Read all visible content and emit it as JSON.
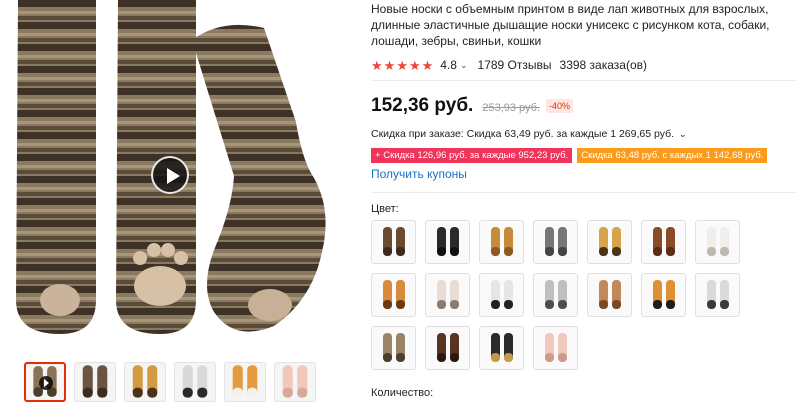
{
  "product": {
    "title": "Новые носки с объемным принтом в виде лап животных для взрослых, длинные эластичные дышащие носки унисекс с рисунком кота, собаки, лошади, зебры, свиньи, кошки",
    "rating": "4.8",
    "reviews": "1789 Отзывы",
    "orders": "3398 заказа(ов)",
    "star_count": 5
  },
  "price": {
    "current": "152,36 руб.",
    "original": "253,93 руб.",
    "discount": "-40%"
  },
  "promos": {
    "order_discount": "Скидка при заказе: Скидка 63,49 руб. за каждые 1 269,65 руб.",
    "coupon_red": "Скидка 126,96 руб. за каждые 952,23 руб.",
    "coupon_orange": "Скидка 63,48 руб. с каждых 1 142,68 руб.",
    "get_coupons": "Получить купоны"
  },
  "options": {
    "color_label": "Цвет:",
    "quantity_label": "Количество:",
    "swatches": [
      {
        "name": "brown-stripe",
        "colors": [
          "#6b4a32",
          "#3d2a1e"
        ]
      },
      {
        "name": "black",
        "colors": [
          "#2a2a2a",
          "#111111"
        ]
      },
      {
        "name": "golden",
        "colors": [
          "#c68a3a",
          "#8a5a22"
        ]
      },
      {
        "name": "grey",
        "colors": [
          "#777777",
          "#444444"
        ]
      },
      {
        "name": "leopard",
        "colors": [
          "#d8a34a",
          "#4a3418"
        ]
      },
      {
        "name": "chestnut",
        "colors": [
          "#8a4b28",
          "#5a2e16"
        ]
      },
      {
        "name": "white",
        "colors": [
          "#f0eeea",
          "#bdb8b0"
        ]
      },
      {
        "name": "tiger-orange",
        "colors": [
          "#d98a3c",
          "#6a3a14"
        ]
      },
      {
        "name": "pink-white",
        "colors": [
          "#e8dcd6",
          "#8a7b72"
        ]
      },
      {
        "name": "zebra",
        "colors": [
          "#e6e6e6",
          "#222222"
        ]
      },
      {
        "name": "snow-leopard",
        "colors": [
          "#bfbfbf",
          "#4d4d4d"
        ]
      },
      {
        "name": "ginger-cat",
        "colors": [
          "#c28a5a",
          "#7a4a28"
        ]
      },
      {
        "name": "tiger",
        "colors": [
          "#e09030",
          "#1e1e1e"
        ]
      },
      {
        "name": "dalmatian",
        "colors": [
          "#dadada",
          "#3a3a3a"
        ]
      },
      {
        "name": "tabby",
        "colors": [
          "#9a8468",
          "#4e3e2c"
        ]
      },
      {
        "name": "dark-brown",
        "colors": [
          "#5a3422",
          "#2c1a10"
        ]
      },
      {
        "name": "black-gold",
        "colors": [
          "#2a2a2a",
          "#c29a4a"
        ]
      },
      {
        "name": "pig-pink",
        "colors": [
          "#f0c8bc",
          "#d09a8a"
        ]
      }
    ]
  },
  "gallery": {
    "thumbs": [
      {
        "name": "thumb-video",
        "colors": [
          "#8a7458",
          "#4c3c2a"
        ],
        "video": true
      },
      {
        "name": "thumb-2",
        "colors": [
          "#6a5540",
          "#3c2c1e"
        ],
        "video": false
      },
      {
        "name": "thumb-3",
        "colors": [
          "#d49a42",
          "#4a3418"
        ],
        "video": false
      },
      {
        "name": "thumb-4",
        "colors": [
          "#d9d9d9",
          "#2a2a2a"
        ],
        "video": false
      },
      {
        "name": "thumb-5",
        "colors": [
          "#e49a3e",
          "#f5f1ea"
        ],
        "video": false
      },
      {
        "name": "thumb-6",
        "colors": [
          "#f0c8bc",
          "#d8a898"
        ],
        "video": false
      }
    ]
  }
}
